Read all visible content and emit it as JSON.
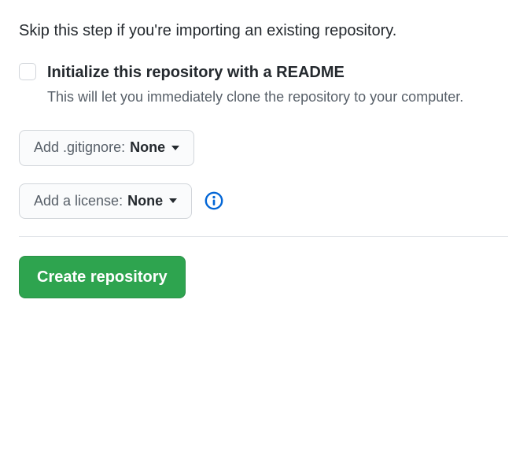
{
  "skip_text": "Skip this step if you're importing an existing repository.",
  "init_readme": {
    "label": "Initialize this repository with a README",
    "description": "This will let you immediately clone the repository to your computer.",
    "checked": false
  },
  "gitignore": {
    "prefix": "Add .gitignore: ",
    "value": "None"
  },
  "license": {
    "prefix": "Add a license: ",
    "value": "None"
  },
  "create_button_label": "Create repository"
}
